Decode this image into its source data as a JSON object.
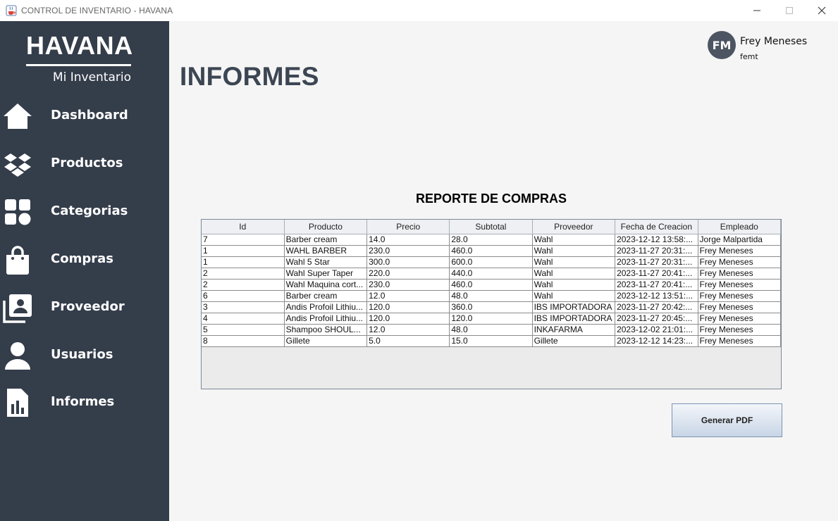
{
  "window": {
    "title": "CONTROL DE INVENTARIO - HAVANA",
    "app_icon": "java-cup-icon"
  },
  "sidebar": {
    "brand": "HAVANA",
    "subtitle": "Mi Inventario",
    "background": "#343d4a",
    "items": [
      {
        "label": "Dashboard",
        "icon": "home-icon"
      },
      {
        "label": "Productos",
        "icon": "dropbox-icon"
      },
      {
        "label": "Categorias",
        "icon": "grid-icon"
      },
      {
        "label": "Compras",
        "icon": "shopping-bag-icon"
      },
      {
        "label": "Proveedor",
        "icon": "contacts-icon"
      },
      {
        "label": "Usuarios",
        "icon": "user-icon"
      },
      {
        "label": "Informes",
        "icon": "report-icon"
      }
    ]
  },
  "header": {
    "page_title": "INFORMES",
    "user": {
      "initials": "FM",
      "name": "Frey Meneses",
      "handle": "femt"
    }
  },
  "report": {
    "title": "REPORTE DE COMPRAS",
    "columns": [
      "Id",
      "Producto",
      "Precio",
      "Subtotal",
      "Proveedor",
      "Fecha de Creacion",
      "Empleado"
    ],
    "rows": [
      [
        "7",
        "Barber cream",
        "14.0",
        "28.0",
        "Wahl",
        "2023-12-12 13:58:...",
        "Jorge Malpartida"
      ],
      [
        "1",
        "WAHL BARBER",
        "230.0",
        "460.0",
        "Wahl",
        "2023-11-27 20:31:...",
        "Frey Meneses"
      ],
      [
        "1",
        "Wahl 5 Star",
        "300.0",
        "600.0",
        "Wahl",
        "2023-11-27 20:31:...",
        "Frey Meneses"
      ],
      [
        "2",
        "Wahl Super Taper",
        "220.0",
        "440.0",
        "Wahl",
        "2023-11-27 20:41:...",
        "Frey Meneses"
      ],
      [
        "2",
        "Wahl Maquina cort...",
        "230.0",
        "460.0",
        "Wahl",
        "2023-11-27 20:41:...",
        "Frey Meneses"
      ],
      [
        "6",
        "Barber cream",
        "12.0",
        "48.0",
        "Wahl",
        "2023-12-12 13:51:...",
        "Frey Meneses"
      ],
      [
        "3",
        "Andis Profoil Lithiu...",
        "120.0",
        "360.0",
        "IBS IMPORTADORA",
        "2023-11-27 20:42:...",
        "Frey Meneses"
      ],
      [
        "4",
        "Andis Profoil Lithiu...",
        "120.0",
        "120.0",
        "IBS IMPORTADORA",
        "2023-11-27 20:45:...",
        "Frey Meneses"
      ],
      [
        "5",
        "Shampoo SHOUL...",
        "12.0",
        "48.0",
        "INKAFARMA",
        "2023-12-02 21:01:...",
        "Frey Meneses"
      ],
      [
        "8",
        "Gillete",
        "5.0",
        "15.0",
        "Gillete",
        "2023-12-12 14:23:...",
        "Frey Meneses"
      ]
    ],
    "button_label": "Generar PDF"
  }
}
